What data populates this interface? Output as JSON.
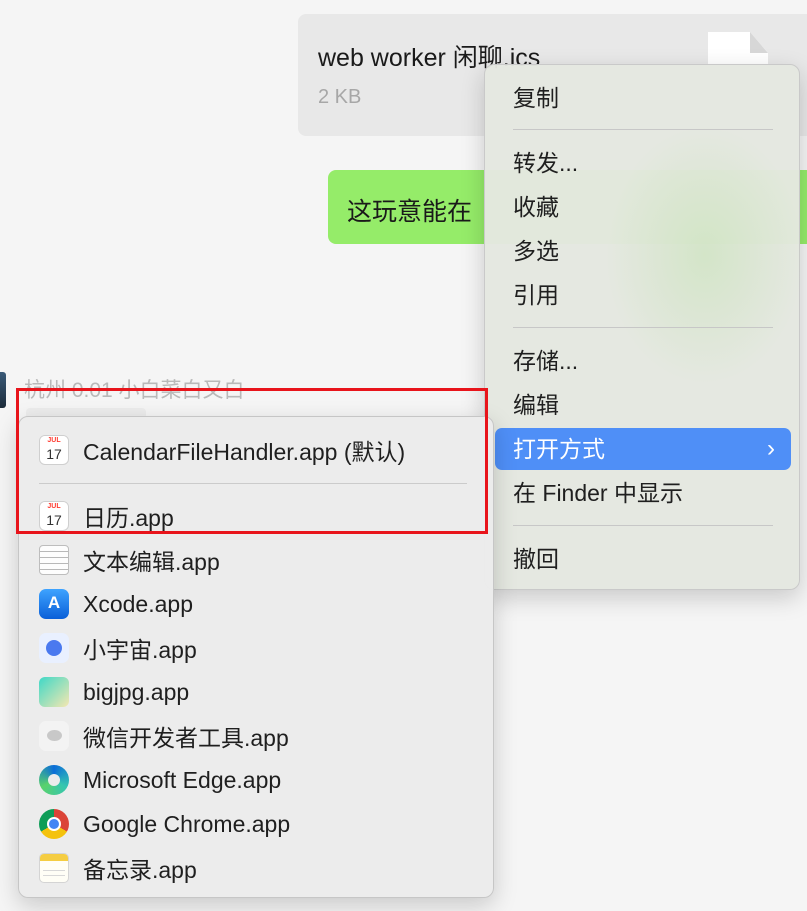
{
  "chat": {
    "file_name": "web worker 闲聊.ics",
    "file_size": "2 KB",
    "green_message": "这玩意能在",
    "sender_line": "杭州 0.01 小白菜白又白"
  },
  "context_menu": {
    "items": [
      {
        "label": "复制"
      },
      {
        "label": "转发..."
      },
      {
        "label": "收藏"
      },
      {
        "label": "多选"
      },
      {
        "label": "引用"
      },
      {
        "label": "存储..."
      },
      {
        "label": "编辑"
      },
      {
        "label": "打开方式",
        "active": true
      },
      {
        "label": "在 Finder 中显示"
      },
      {
        "label": "撤回"
      }
    ],
    "chevron": "›",
    "active_color": "#4f8ff7"
  },
  "open_with": {
    "items": [
      {
        "label": "CalendarFileHandler.app (默认)",
        "icon": "calendar-icon",
        "icon_month": "JUL",
        "icon_day": "17"
      },
      {
        "label": "日历.app",
        "icon": "calendar-icon",
        "icon_month": "JUL",
        "icon_day": "17"
      },
      {
        "label": "文本编辑.app",
        "icon": "textedit-icon"
      },
      {
        "label": "Xcode.app",
        "icon": "xcode-icon"
      },
      {
        "label": "小宇宙.app",
        "icon": "xiaoyuzhou-icon"
      },
      {
        "label": "bigjpg.app",
        "icon": "bigjpg-icon"
      },
      {
        "label": "微信开发者工具.app",
        "icon": "wechat-devtools-icon"
      },
      {
        "label": "Microsoft Edge.app",
        "icon": "edge-icon"
      },
      {
        "label": "Google Chrome.app",
        "icon": "chrome-icon"
      },
      {
        "label": "备忘录.app",
        "icon": "notes-icon"
      }
    ]
  },
  "annotation": {
    "highlight_color": "#e8141b"
  }
}
